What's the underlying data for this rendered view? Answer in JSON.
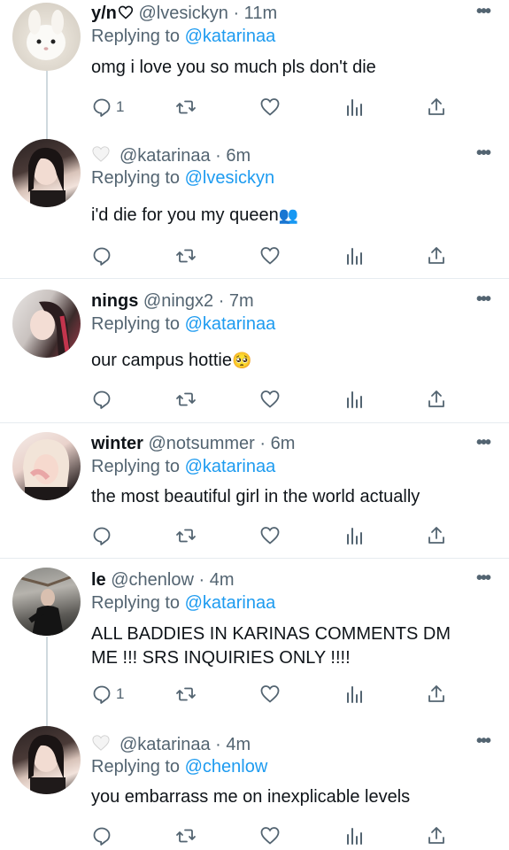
{
  "tweets": [
    {
      "name": "y/n",
      "name_suffix_icon": "heart-outline-icon",
      "handle": "@lvesickyn",
      "time": "· 11m",
      "replying_label": "Replying to",
      "replying_to": "@katarinaa",
      "text": "omg i love you so much pls don't die",
      "reply_count": "1",
      "avatar": "white-bunny"
    },
    {
      "name": "",
      "name_prefix_icon": "white-heart-emoji",
      "handle": "@katarinaa",
      "time": "· 6m",
      "replying_label": "Replying to",
      "replying_to": "@lvesickyn",
      "text": "i'd die for you my queen",
      "text_emoji": "👥",
      "reply_count": "",
      "avatar": "karina"
    },
    {
      "name": "nings",
      "handle": "@ningx2",
      "time": "· 7m",
      "replying_label": "Replying to",
      "replying_to": "@katarinaa",
      "text": "our campus hottie",
      "text_emoji": "🥺",
      "reply_count": "",
      "avatar": "ning"
    },
    {
      "name": "winter",
      "handle": "@notsummer",
      "time": "· 6m",
      "replying_label": "Replying to",
      "replying_to": "@katarinaa",
      "text": "the most beautiful girl in the world actually",
      "reply_count": "",
      "avatar": "winter"
    },
    {
      "name": "le",
      "handle": "@chenlow",
      "time": "· 4m",
      "replying_label": "Replying to",
      "replying_to": "@katarinaa",
      "text": "ALL BADDIES IN KARINAS COMMENTS DM ME !!! SRS INQUIRIES ONLY !!!!",
      "reply_count": "1",
      "avatar": "le"
    },
    {
      "name": "",
      "name_prefix_icon": "white-heart-emoji",
      "handle": "@katarinaa",
      "time": "· 4m",
      "replying_label": "Replying to",
      "replying_to": "@chenlow",
      "text": "you embarrass me on inexplicable levels",
      "reply_count": "",
      "avatar": "karina"
    }
  ],
  "more_label": "•••",
  "colors": {
    "link": "#1d9bf0",
    "secondary": "#536471",
    "thread_line": "#cfd9de"
  }
}
